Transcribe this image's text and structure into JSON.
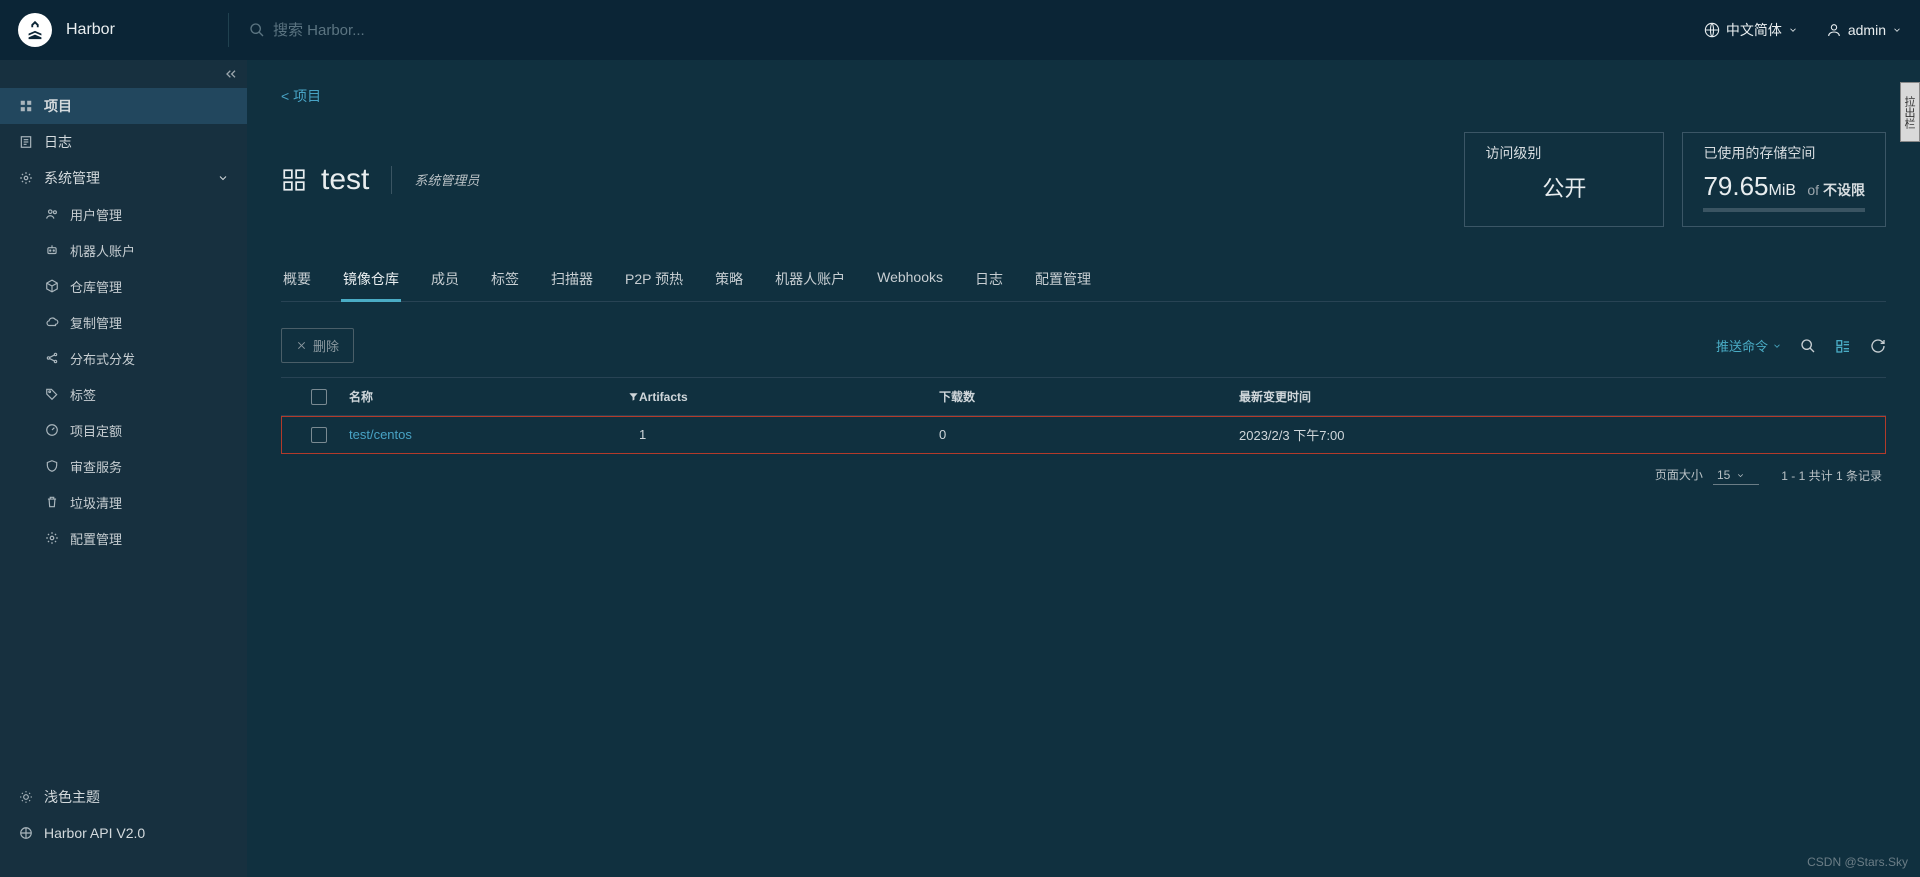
{
  "header": {
    "product": "Harbor",
    "search_placeholder": "搜索 Harbor...",
    "lang": "中文简体",
    "user": "admin"
  },
  "sidebar": {
    "items": [
      {
        "label": "项目"
      },
      {
        "label": "日志"
      },
      {
        "label": "系统管理"
      },
      {
        "label": "用户管理"
      },
      {
        "label": "机器人账户"
      },
      {
        "label": "仓库管理"
      },
      {
        "label": "复制管理"
      },
      {
        "label": "分布式分发"
      },
      {
        "label": "标签"
      },
      {
        "label": "项目定额"
      },
      {
        "label": "审查服务"
      },
      {
        "label": "垃圾清理"
      },
      {
        "label": "配置管理"
      }
    ],
    "bottom": [
      {
        "label": "浅色主题"
      },
      {
        "label": "Harbor API V2.0"
      }
    ]
  },
  "main": {
    "breadcrumb_back": "< 项目",
    "project_name": "test",
    "role": "系统管理员",
    "access_card": {
      "cap": "访问级别",
      "value": "公开"
    },
    "storage_card": {
      "cap": "已使用的存储空间",
      "value": "79.65",
      "unit": "MiB",
      "of": "of",
      "limit": "不设限"
    },
    "tabs": [
      "概要",
      "镜像仓库",
      "成员",
      "标签",
      "扫描器",
      "P2P 预热",
      "策略",
      "机器人账户",
      "Webhooks",
      "日志",
      "配置管理"
    ],
    "active_tab": 1,
    "toolbar": {
      "delete": "删除",
      "push": "推送命令"
    },
    "table": {
      "headers": {
        "name": "名称",
        "artifacts": "Artifacts",
        "downloads": "下载数",
        "updated": "最新变更时间"
      },
      "rows": [
        {
          "name": "test/centos",
          "artifacts": "1",
          "downloads": "0",
          "updated": "2023/2/3 下午7:00"
        }
      ]
    },
    "pager": {
      "page_size_label": "页面大小",
      "page_size": "15",
      "range": "1 - 1 共计 1 条记录"
    }
  },
  "side_handle": "拉出栏",
  "watermark": "CSDN @Stars.Sky"
}
